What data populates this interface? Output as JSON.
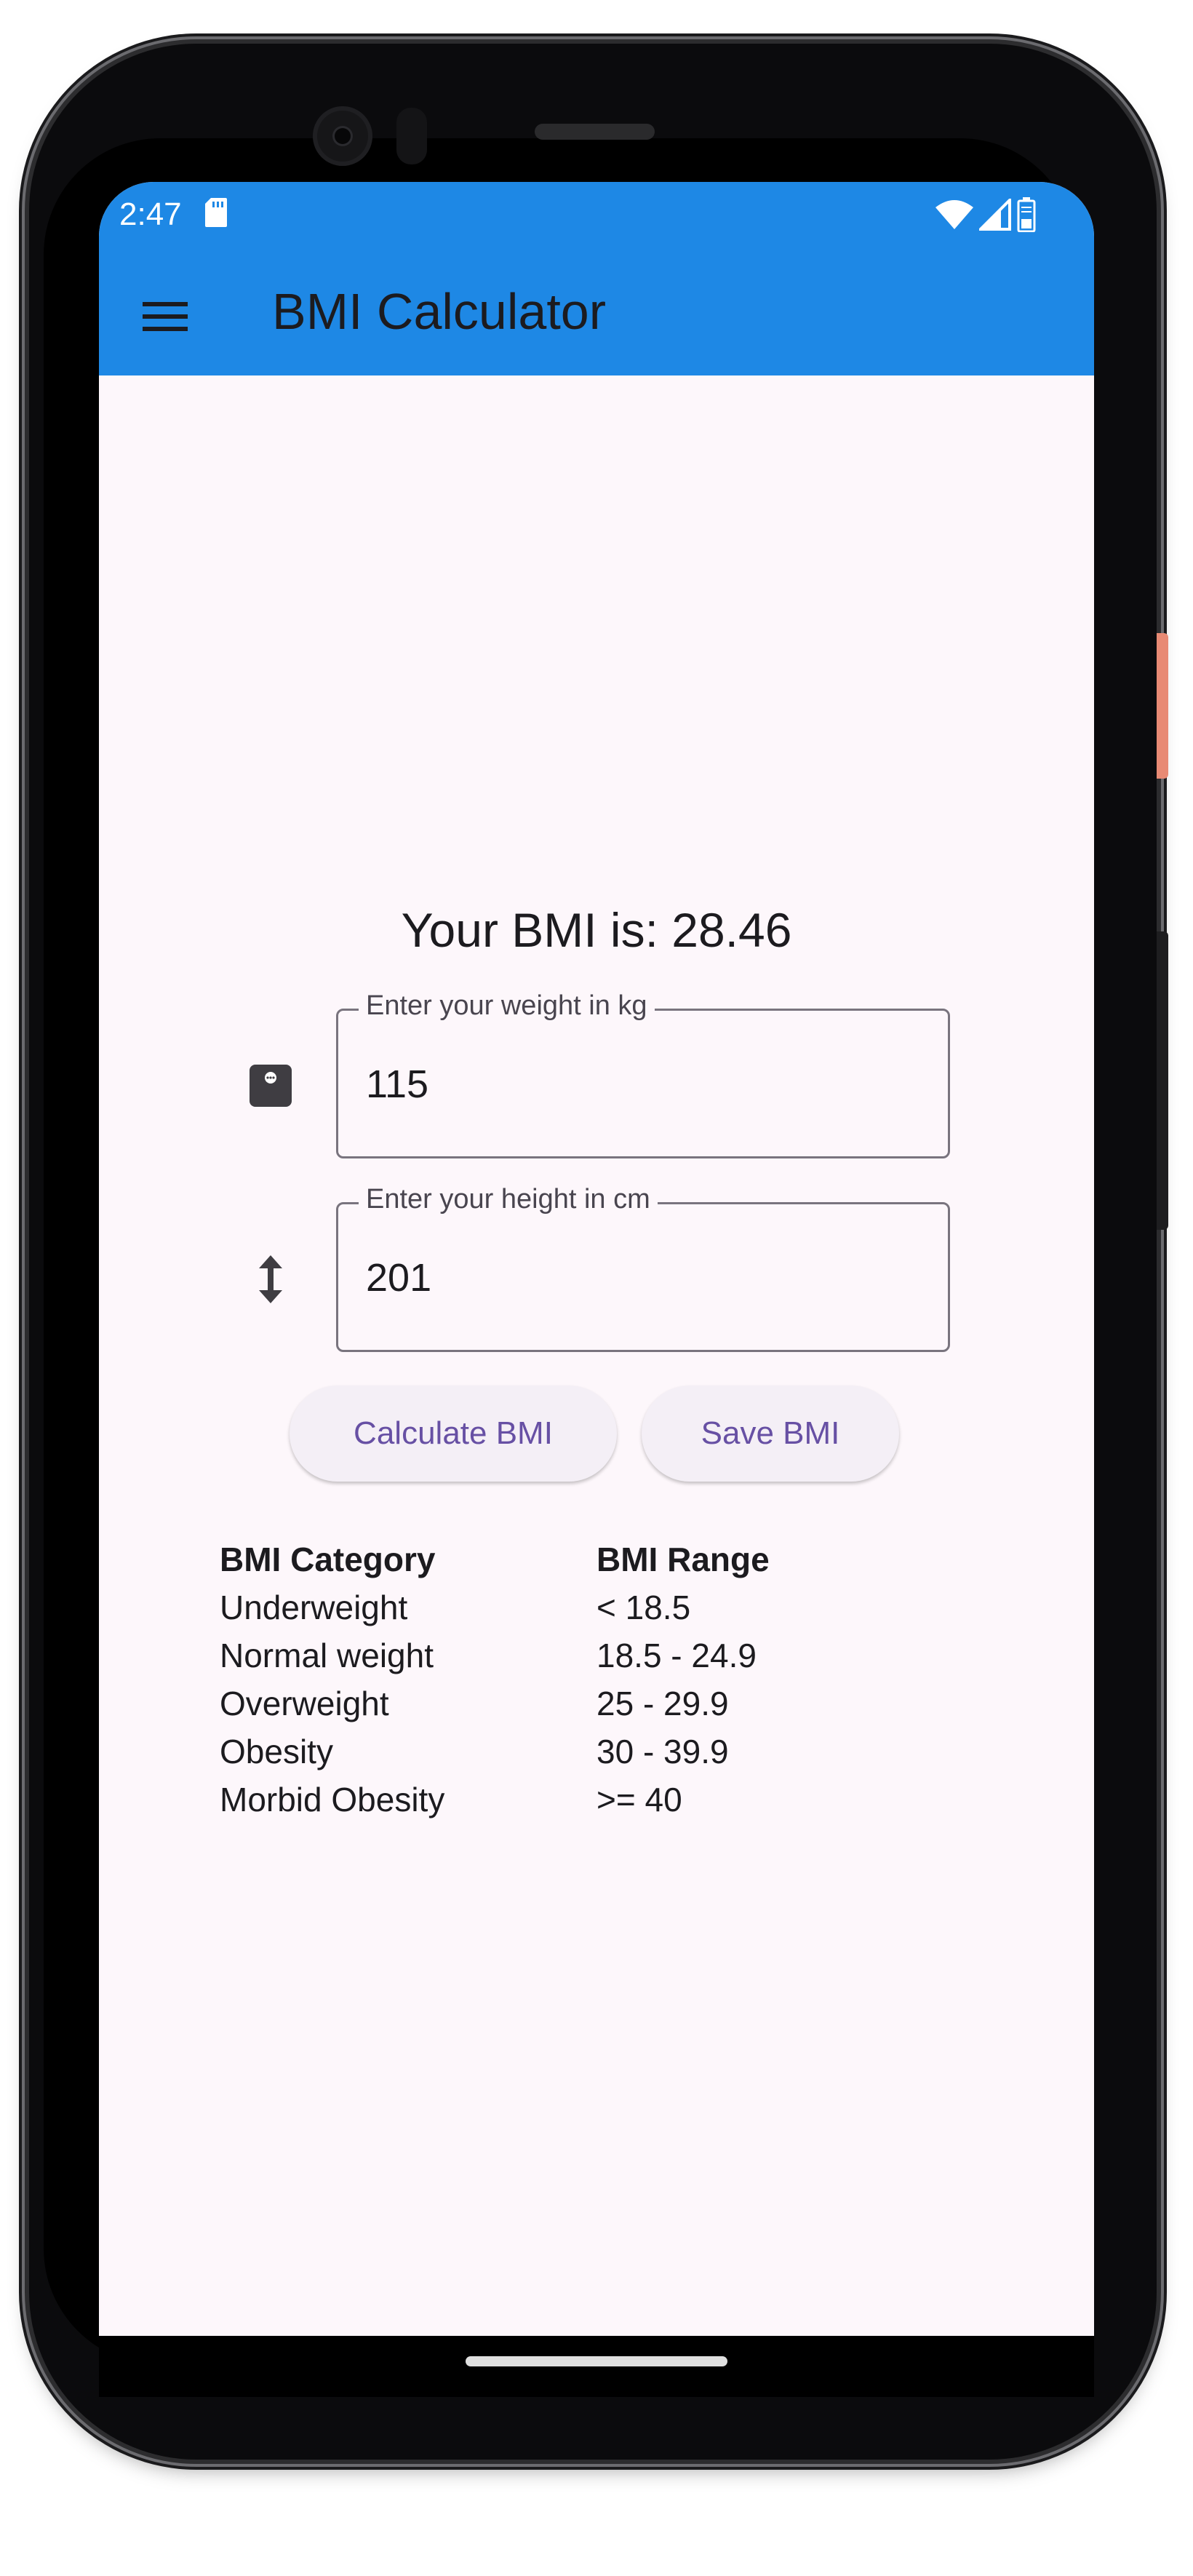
{
  "status_bar": {
    "time": "2:47",
    "icons": [
      "sd-card-icon",
      "wifi-icon",
      "cell-signal-icon",
      "battery-icon"
    ]
  },
  "app_bar": {
    "title": "BMI Calculator",
    "menu_icon": "menu-icon",
    "color": "#1e88e5"
  },
  "result": {
    "text": "Your BMI is: 28.46"
  },
  "weight_field": {
    "label": "Enter your weight in kg",
    "value": "115",
    "icon": "scale-icon"
  },
  "height_field": {
    "label": "Enter your height in cm",
    "value": "201",
    "icon": "height-icon"
  },
  "buttons": {
    "calculate": "Calculate BMI",
    "save": "Save BMI"
  },
  "table": {
    "headers": [
      "BMI Category",
      "BMI Range"
    ],
    "rows": [
      [
        "Underweight",
        "< 18.5"
      ],
      [
        "Normal weight",
        "18.5 - 24.9"
      ],
      [
        "Overweight",
        "25 - 29.9"
      ],
      [
        "Obesity",
        "30 - 39.9"
      ],
      [
        "Morbid Obesity",
        ">= 40"
      ]
    ]
  },
  "colors": {
    "accent": "#6750a4",
    "background": "#fdf7fb"
  }
}
